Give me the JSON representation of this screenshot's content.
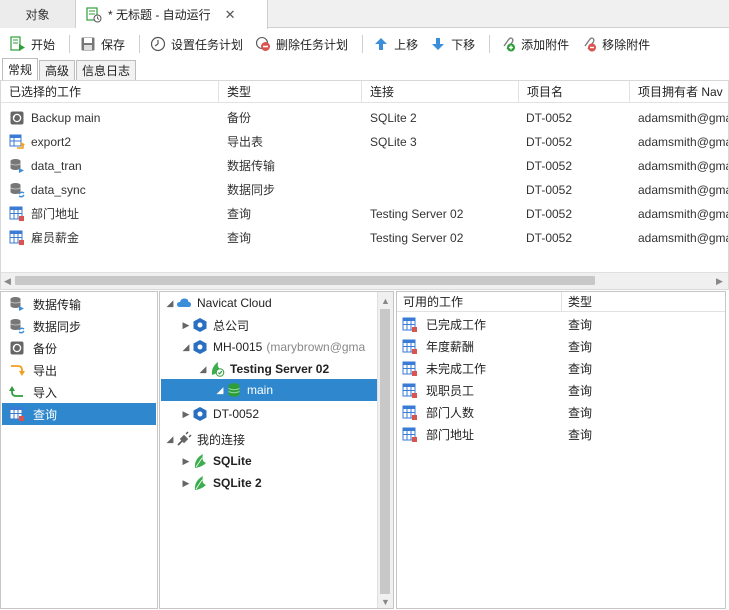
{
  "tabs": [
    {
      "label": "对象"
    },
    {
      "label": "* 无标题 - 自动运行"
    }
  ],
  "toolbar": {
    "start": "开始",
    "save": "保存",
    "set_schedule": "设置任务计划",
    "delete_schedule": "删除任务计划",
    "move_up": "上移",
    "move_down": "下移",
    "add_attachment": "添加附件",
    "remove_attachment": "移除附件"
  },
  "subtabs": [
    "常规",
    "高级",
    "信息日志"
  ],
  "jobs": {
    "columns": [
      "已选择的工作",
      "类型",
      "连接",
      "项目名",
      "项目拥有者 Nav"
    ],
    "rows": [
      {
        "icon": "backup-icon",
        "name": "Backup main",
        "type": "备份",
        "connection": "SQLite 2",
        "project": "DT-0052",
        "owner": "adamsmith@gma"
      },
      {
        "icon": "export-icon",
        "name": "export2",
        "type": "导出表",
        "connection": "SQLite 3",
        "project": "DT-0052",
        "owner": "adamsmith@gma"
      },
      {
        "icon": "data-transfer-icon",
        "name": "data_tran",
        "type": "数据传输",
        "connection": "",
        "project": "DT-0052",
        "owner": "adamsmith@gma"
      },
      {
        "icon": "data-sync-icon",
        "name": "data_sync",
        "type": "数据同步",
        "connection": "",
        "project": "DT-0052",
        "owner": "adamsmith@gma"
      },
      {
        "icon": "query-icon",
        "name": "部门地址",
        "type": "查询",
        "connection": "Testing Server 02",
        "project": "DT-0052",
        "owner": "adamsmith@gma"
      },
      {
        "icon": "query-icon",
        "name": "雇员薪金",
        "type": "查询",
        "connection": "Testing Server 02",
        "project": "DT-0052",
        "owner": "adamsmith@gma"
      }
    ]
  },
  "categories": [
    {
      "icon": "data-transfer-icon",
      "label": "数据传输"
    },
    {
      "icon": "data-sync-icon",
      "label": "数据同步"
    },
    {
      "icon": "backup-icon",
      "label": "备份"
    },
    {
      "icon": "export-icon",
      "label": "导出"
    },
    {
      "icon": "import-icon",
      "label": "导入"
    },
    {
      "icon": "query-icon",
      "label": "查询",
      "selected": true
    }
  ],
  "tree": {
    "cloud": "Navicat Cloud",
    "hq": "总公司",
    "mh": "MH-0015",
    "mh_owner": "(marybrown@gma",
    "server": "Testing Server 02",
    "db": "main",
    "dt": "DT-0052",
    "my_connections": "我的连接",
    "sqlite": "SQLite",
    "sqlite2": "SQLite 2"
  },
  "available": {
    "columns": [
      "可用的工作",
      "类型"
    ],
    "rows": [
      {
        "name": "已完成工作",
        "type": "查询"
      },
      {
        "name": "年度薪酬",
        "type": "查询"
      },
      {
        "name": "未完成工作",
        "type": "查询"
      },
      {
        "name": "现职员工",
        "type": "查询"
      },
      {
        "name": "部门人数",
        "type": "查询"
      },
      {
        "name": "部门地址",
        "type": "查询"
      }
    ]
  },
  "colors": {
    "selection": "#2f88cd",
    "query_blue": "#3a7bd5",
    "green": "#2e9e3a",
    "orange": "#f0a020",
    "red": "#d9534f"
  }
}
